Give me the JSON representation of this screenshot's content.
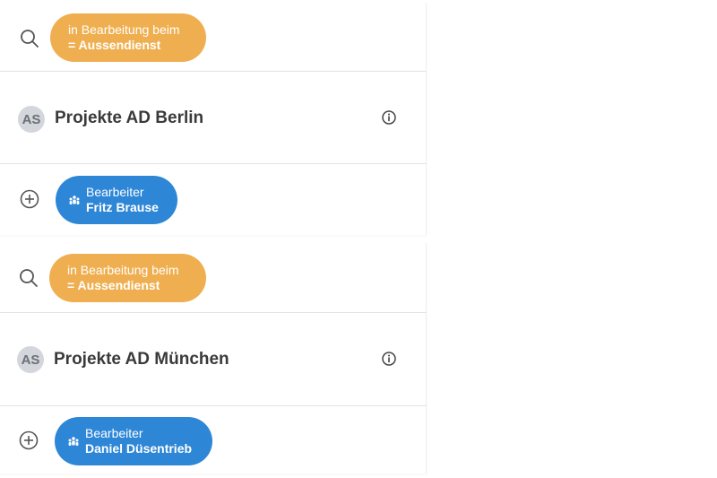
{
  "groups": [
    {
      "filter_line1": "in Bearbeitung beim",
      "filter_line2": "= Aussendienst",
      "avatar_initials": "AS",
      "title": "Projekte AD Berlin",
      "assignee_label": "Bearbeiter",
      "assignee_name": "Fritz Brause"
    },
    {
      "filter_line1": "in Bearbeitung beim",
      "filter_line2": "= Aussendienst",
      "avatar_initials": "AS",
      "title": "Projekte AD München",
      "assignee_label": "Bearbeiter",
      "assignee_name": "Daniel Düsentrieb"
    }
  ],
  "colors": {
    "filter_pill": "#efaf50",
    "assignee_pill": "#2e86d6",
    "avatar_bg": "#d3d6db"
  },
  "icons": [
    "search-icon",
    "info-icon",
    "add-circle-icon",
    "team-icon"
  ]
}
